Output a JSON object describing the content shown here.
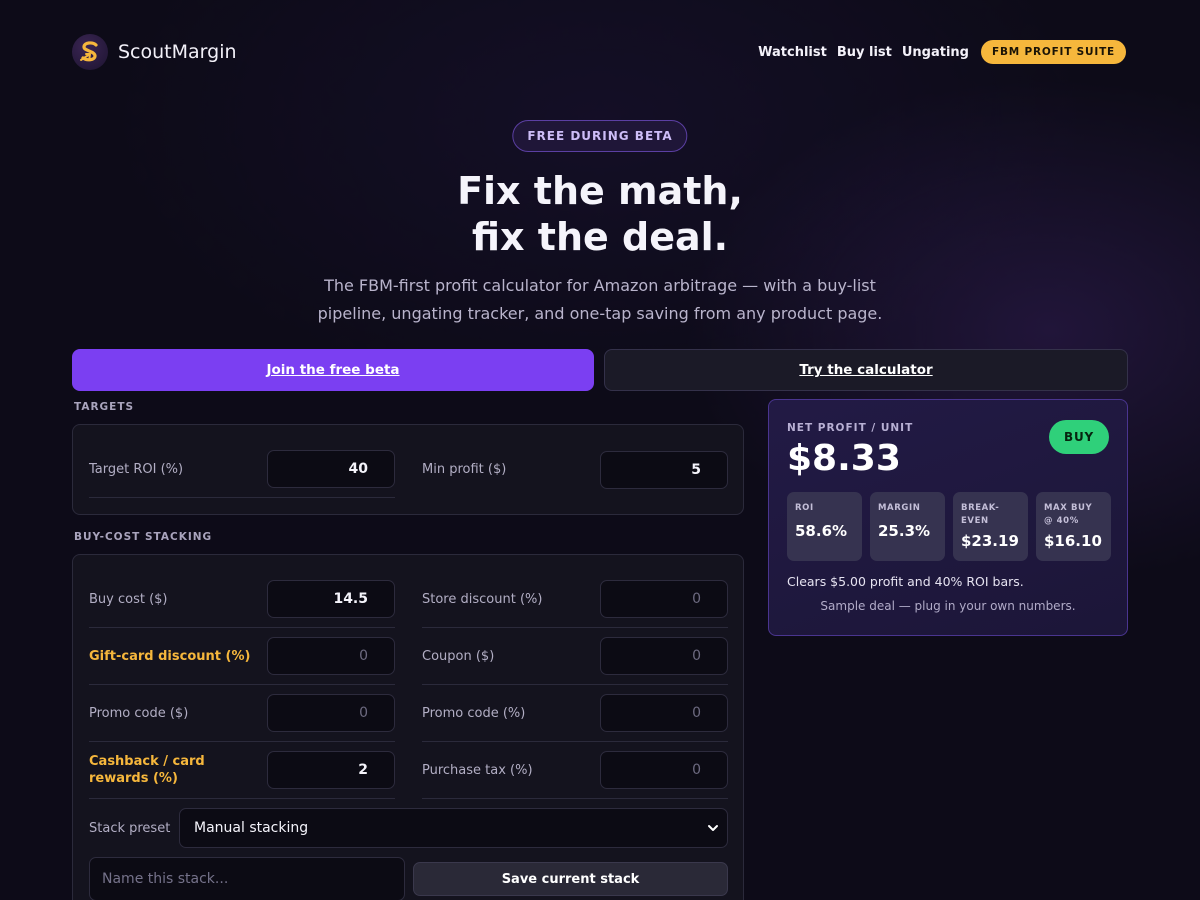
{
  "nav": {
    "brand": "ScoutMargin",
    "links": [
      "Watchlist",
      "Buy list",
      "Ungating"
    ],
    "pill": "FBM PROFIT SUITE"
  },
  "hero": {
    "badge": "FREE DURING BETA",
    "title_line1": "Fix the math,",
    "title_line2": "fix the deal.",
    "subtitle_line1": "The FBM-first profit calculator for Amazon arbitrage — with a buy-list",
    "subtitle_line2": "pipeline, ungating tracker, and one-tap saving from any product page."
  },
  "cta": {
    "primary": "Join the free beta",
    "secondary": "Try the calculator"
  },
  "targets": {
    "label": "TARGETS",
    "roi_label": "Target ROI (%)",
    "roi_value": "40",
    "min_profit_label": "Min profit ($)",
    "min_profit_value": "5"
  },
  "stacking": {
    "label": "BUY-COST STACKING",
    "fields": [
      {
        "label": "Buy cost ($)",
        "value": "14.5"
      },
      {
        "label": "Store discount (%)",
        "value": "0"
      },
      {
        "label": "Gift-card discount (%)",
        "value": "0"
      },
      {
        "label": "Coupon ($)",
        "value": "0"
      },
      {
        "label": "Promo code ($)",
        "value": "0"
      },
      {
        "label": "Promo code (%)",
        "value": "0"
      },
      {
        "label": "Cashback / card rewards (%)",
        "value": "2"
      },
      {
        "label": "Purchase tax (%)",
        "value": "0"
      }
    ],
    "preset_label": "Stack preset",
    "preset_value": "Manual stacking",
    "name_placeholder": "Name this stack...",
    "save_label": "Save current stack"
  },
  "result": {
    "label": "NET PROFIT / UNIT",
    "value": "$8.33",
    "badge": "BUY",
    "stats": [
      {
        "label": "ROI",
        "value": "58.6%"
      },
      {
        "label": "MARGIN",
        "value": "25.3%"
      },
      {
        "label": "BREAK-EVEN",
        "value": "$23.19"
      },
      {
        "label": "MAX BUY @ 40%",
        "value": "$16.10"
      }
    ],
    "clears": "Clears $5.00 profit and 40% ROI bars.",
    "sample": "Sample deal — plug in your own numbers."
  },
  "colors": {
    "accent_purple": "#7b3ff2",
    "accent_gold": "#f6b73c",
    "buy_green": "#2fd07a",
    "background": "#0d0b18"
  }
}
